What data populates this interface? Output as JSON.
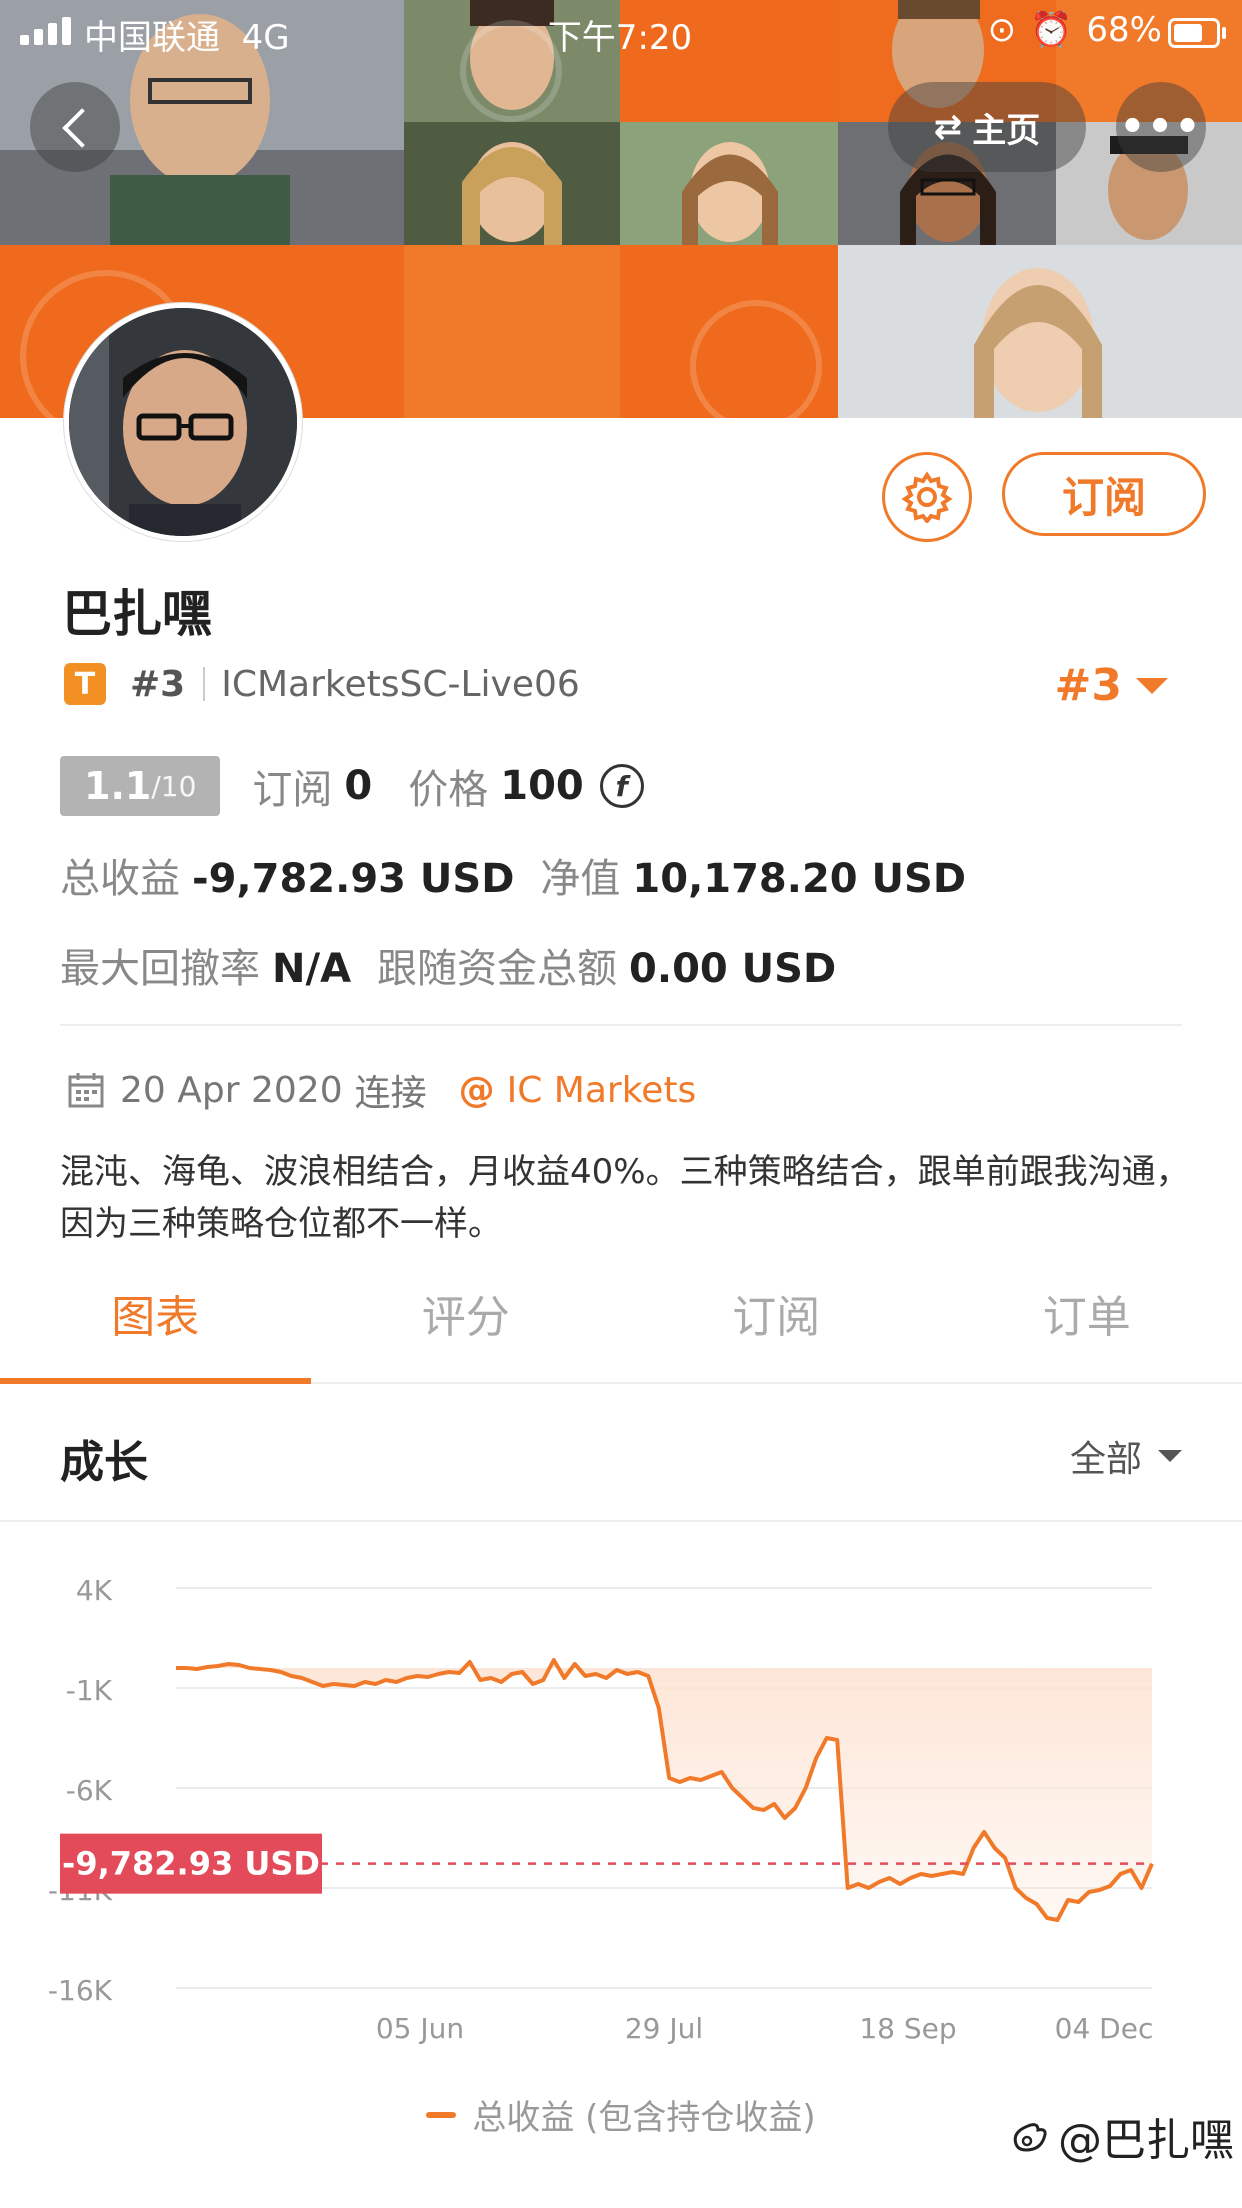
{
  "status_bar": {
    "carrier": "中国联通",
    "network": "4G",
    "time": "下午7:20",
    "battery": "68%"
  },
  "header": {
    "home_label": "主页",
    "more_label": "•••"
  },
  "profile": {
    "name": "巴扎嘿",
    "badge": "T",
    "rank": "#3",
    "account": "ICMarketsSC-Live06",
    "rank_right": "#3",
    "subscribe_label": "订阅",
    "score": "1.1",
    "score_max": "/10",
    "subs_label": "订阅",
    "subs_value": "0",
    "price_label": "价格",
    "price_value": "100",
    "coin_symbol": "f",
    "total_profit_label": "总收益",
    "total_profit_value": "-9,782.93 USD",
    "equity_label": "净值",
    "equity_value": "10,178.20 USD",
    "max_dd_label": "最大回撤率",
    "max_dd_value": "N/A",
    "follow_label": "跟随资金总额",
    "follow_value": "0.00 USD",
    "connected_date": "20 Apr 2020",
    "connected_label": "连接",
    "broker_at": "@",
    "broker": "IC Markets",
    "description": "混沌、海龟、波浪相结合，月收益40%。三种策略结合，跟单前跟我沟通，因为三种策略仓位都不一样。"
  },
  "tabs": [
    "图表",
    "评分",
    "订阅",
    "订单"
  ],
  "section": {
    "title": "成长",
    "range": "全部"
  },
  "chart_data": {
    "type": "area",
    "ylim": [
      -16000,
      4000
    ],
    "y_ticks": [
      "4K",
      "-1K",
      "-6K",
      "-11K",
      "-16K"
    ],
    "x_ticks": [
      "05 Jun",
      "29 Jul",
      "18 Sep",
      "04 Dec"
    ],
    "current_label": "-9,782.93 USD",
    "current_value": -9782.93,
    "series": [
      {
        "name": "总收益 (包含持仓收益)",
        "values": [
          0,
          0,
          -50,
          50,
          100,
          200,
          150,
          0,
          -50,
          -100,
          -200,
          -400,
          -500,
          -700,
          -900,
          -800,
          -850,
          -900,
          -700,
          -800,
          -600,
          -700,
          -500,
          -400,
          -450,
          -300,
          -200,
          -250,
          300,
          -600,
          -500,
          -700,
          -300,
          -200,
          -800,
          -600,
          400,
          -500,
          200,
          -400,
          -300,
          -500,
          -100,
          -300,
          -200,
          -400,
          -2000,
          -5500,
          -5700,
          -5500,
          -5600,
          -5400,
          -5200,
          -6000,
          -6500,
          -7000,
          -7100,
          -6800,
          -7500,
          -7000,
          -6000,
          -4500,
          -3500,
          -3600,
          -11000,
          -10800,
          -11000,
          -10700,
          -10500,
          -10800,
          -10500,
          -10300,
          -10400,
          -10300,
          -10200,
          -10300,
          -9000,
          -8200,
          -9000,
          -9500,
          -11000,
          -11500,
          -11800,
          -12500,
          -12600,
          -11600,
          -11700,
          -11200,
          -11100,
          -10900,
          -10300,
          -10100,
          -11000,
          -9782.93
        ]
      }
    ],
    "colors": {
      "line": "#f07a2a",
      "fill": "#fde3d2",
      "label_bg": "#e34b5a",
      "reference": "#e34b5a"
    }
  },
  "legend": {
    "label": "总收益 (包含持仓收益)"
  },
  "watermark": "@巴扎嘿",
  "colors": {
    "accent": "#f07a2a",
    "banner": "#ef6c1f"
  }
}
